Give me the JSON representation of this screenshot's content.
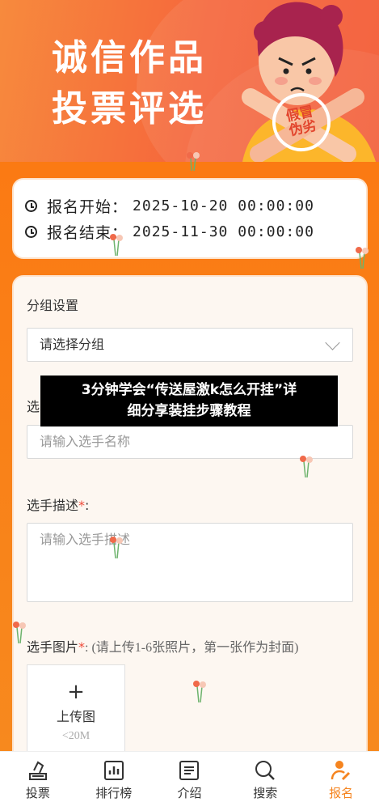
{
  "hero": {
    "title_line1": "诚信作品",
    "title_line2": "投票评选",
    "seal_line1": "假冒",
    "seal_line2": "伪劣"
  },
  "schedule": {
    "start_label": "报名开始：",
    "start_value": "2025-10-20 00:00:00",
    "end_label": "报名结束：",
    "end_value": "2025-11-30 00:00:00"
  },
  "form": {
    "group_label": "分组设置",
    "group_select_value": "请选择分组",
    "name_label": "选",
    "name_placeholder": "请输入选手名称",
    "desc_label": "选手描述",
    "desc_required_mark": "*",
    "desc_colon": ":",
    "desc_placeholder": "请输入选手描述",
    "image_label": "选手图片",
    "image_required_mark": "*",
    "image_hint": ": (请上传1-6张照片，第一张作为封面)",
    "upload_plus": "+",
    "upload_label": "上传图",
    "upload_size": "<20M"
  },
  "overlay_banner": {
    "line1": "3分钟学会“传送屋激k怎么开挂”详",
    "line2": "细分享装挂步骤教程"
  },
  "tabbar": {
    "items": [
      {
        "label": "投票",
        "icon": "vote-icon"
      },
      {
        "label": "排行榜",
        "icon": "ranking-icon"
      },
      {
        "label": "介绍",
        "icon": "intro-icon"
      },
      {
        "label": "搜索",
        "icon": "search-icon"
      },
      {
        "label": "报名",
        "icon": "signup-icon"
      }
    ],
    "active": "报名"
  },
  "colors": {
    "brand": "#f5841f",
    "hero_red": "#f2562f",
    "required": "#f04b3a"
  }
}
